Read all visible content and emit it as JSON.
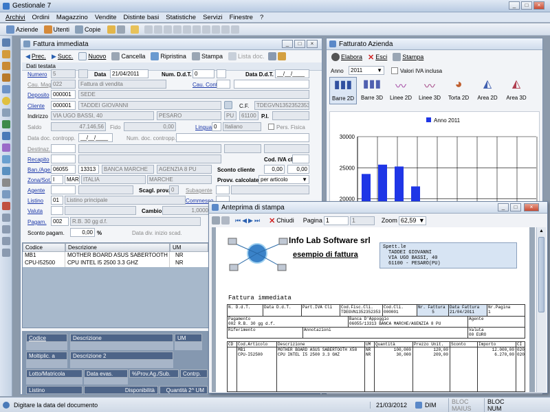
{
  "app": {
    "title": "Gestionale 7"
  },
  "menu": [
    "Archivi",
    "Ordini",
    "Magazzino",
    "Vendite",
    "Distinte basi",
    "Statistiche",
    "Servizi",
    "Finestre",
    "?"
  ],
  "toolbar": {
    "aziende": "Aziende",
    "utenti": "Utenti",
    "copie": "Copie"
  },
  "fattura": {
    "title": "Fattura immediata",
    "toolbar": {
      "prec": "Prec.",
      "succ": "Succ.",
      "nuovo": "Nuovo",
      "cancella": "Cancella",
      "ripristina": "Ripristina",
      "stampa": "Stampa",
      "lista": "Lista doc."
    },
    "section": "Dati testata",
    "numero_label": "Numero",
    "numero": "5",
    "data_label": "Data",
    "data": "21/04/2011",
    "num_ddt_label": "Num. D.d.T.",
    "num_ddt": "0",
    "data_ddt_label": "Data D.d.T.",
    "data_ddt": "__/__/____",
    "cau_mag_label": "Cau. Mag.",
    "cau_mag": "022",
    "cau_mag_desc": "Fattura di vendita",
    "cau_cont_label": "Cau. Cont.",
    "deposito_label": "Deposito",
    "deposito": "000001",
    "deposito_desc": "SEDE",
    "cliente_label": "Cliente",
    "cliente": "000001",
    "cliente_desc": "TADDEI GIOVANNI",
    "cf_label": "C.F.",
    "cf": "TDEGVN1352352353",
    "indirizzo_label": "Indirizzo",
    "indirizzo": "VIA UGO BASSI, 40",
    "citta": "PESARO",
    "prov": "PU",
    "cap": "61100",
    "pi_label": "P.I.",
    "saldo_label": "Saldo",
    "saldo": "47.146,56",
    "fido_label": "Fido",
    "fido": "0,00",
    "lingua_label": "Lingua",
    "lingua": "0",
    "lingua_desc": "Italiano",
    "pers_fisica": "Pers. Fisica",
    "data_doc_label": "Data doc. contropp.",
    "data_doc": "__/__/____",
    "num_doc_label": "Num. doc. contropp.",
    "destinaz_label": "Destinaz.",
    "recapito_label": "Recapito",
    "cod_iva_label": "Cod. IVA cl.",
    "ban_label": "Ban./Age.",
    "abi": "06055",
    "cab": "13313",
    "banca": "BANCA MARCHE",
    "agenzia": "AGENZIA 8 PU",
    "sconto_cliente_label": "Sconto cliente",
    "sconto1": "0,00",
    "sconto2": "0,00",
    "zona_label": "Zona/Sot.",
    "zona": "I",
    "sot": "MAR",
    "zona_desc": "ITALIA",
    "sot_desc": "MARCHE",
    "provv_label": "Provv. calcolate",
    "provv": "per articolo",
    "agente_label": "Agente",
    "scagl_label": "Scagl. prov.",
    "scagl": "0",
    "subagente_label": "Subagente",
    "listino_label": "Listino",
    "listino": "01",
    "listino_desc": "Listino principale",
    "commesso_label": "Commesso",
    "valuta_label": "Valuta",
    "cambio_label": "Cambio",
    "cambio": "1,0000",
    "pagam_label": "Pagam.",
    "pagam": "002",
    "pagam_desc": "R.B. 30 gg d.f.",
    "sconto_pag_label": "Sconto pagam.",
    "sconto_pag": "0,00",
    "perc": "%",
    "data_div_label": "Data div. inizio scad.",
    "grid_headers": [
      "Codice",
      "Descrizione",
      "UM"
    ],
    "rows": [
      {
        "codice": "MB1",
        "descr": "MOTHER BOARD ASUS SABERTOOTH X58",
        "um": "NR"
      },
      {
        "codice": "CPU-I52500",
        "descr": "CPU INTEL I5 2500 3.3 GHZ",
        "um": "NR"
      }
    ],
    "bottom": {
      "codice": "Codice",
      "descrizione": "Descrizione",
      "um": "UM",
      "moltiplic": "Moltiplic. a UM1",
      "descrizione2": "Descrizione 2",
      "lotto": "Lotto/Matricola",
      "data_evas": "Data evas.",
      "prov_ag": "%Prov.Ag./Sub.",
      "controp": "Contrp.",
      "listino": "Listino",
      "disponibilita": "Disponibilità",
      "quantita": "Quantità 2^ UM"
    }
  },
  "fatturato": {
    "title": "Fatturato Azienda",
    "elabora": "Elabora",
    "esci": "Esci",
    "stampa": "Stampa",
    "anno_label": "Anno",
    "anno": "2011",
    "iva_label": "Valori IVA inclusa",
    "types": [
      "Barre 2D",
      "Barre 3D",
      "Linee 2D",
      "Linee 3D",
      "Torta 2D",
      "Area 2D",
      "Area 3D"
    ]
  },
  "chart_data": {
    "type": "bar",
    "series": [
      {
        "name": "Anno 2011",
        "values": [
          24000,
          25500,
          25200,
          22000
        ]
      }
    ],
    "categories": [
      "1",
      "2",
      "3",
      "4"
    ],
    "yticks": [
      30000,
      25000,
      20000,
      15000
    ],
    "ylim": [
      13000,
      30000
    ]
  },
  "anteprima": {
    "title": "Anteprima di stampa",
    "chiudi": "Chiudi",
    "pagina_label": "Pagina",
    "pagina": "1",
    "pagina_tot": "1",
    "zoom_label": "Zoom",
    "zoom": "62,59",
    "company": "Info Lab Software srl",
    "subtitle": "esempio di fattura",
    "spett": "Spett.le",
    "dest1": "TADDEI GIOVANNI",
    "dest2": "VIA UGO BASSI, 40",
    "dest3": "61100 - PESARO(PU)",
    "doc_title": "Fattura immediata",
    "h1": [
      "N. D.d.T.",
      "Data D.d.T.",
      "Part.IVA Cli",
      "Cod.Fisc.Cli.",
      "Cod.Cli.",
      "Nr. Fattura",
      "Data Fattura",
      "Nr.Pagina"
    ],
    "v1": [
      "",
      "",
      "",
      "TDEGVN1352352353",
      "000001",
      "5",
      "21/04/2011",
      "1"
    ],
    "pag_label": "Pagamento",
    "pag": "002 R.B. 30 gg d.f.",
    "banca_label": "Banca D'Appoggio",
    "banca": "06055/13313 BANCA MARCHE/AGENZIA 8 PU",
    "agente_label": "Agente",
    "rif_label": "Riferimento",
    "annot_label": "Annotazioni",
    "valuta_label": "Valuta",
    "valuta": "00 EURO",
    "th": [
      "CD",
      "Cod.Articolo",
      "Descrizione",
      "UM",
      "Quantità",
      "Prezzo Unit.",
      "Sconto",
      "Importo",
      "CI"
    ],
    "tr": [
      {
        "cod": "MB1",
        "descr": "MOTHER BOARD ASUS SABERTOOTH X58",
        "um": "NR",
        "qta": "100,000",
        "prezzo": "120,00",
        "importo": "12.000,00",
        "ci": "020"
      },
      {
        "cod": "CPU-I52500",
        "descr": "CPU INTEL I5 2500 3.3 GHZ",
        "um": "NR",
        "qta": "30,000",
        "prezzo": "209,00",
        "importo": "6.270,00",
        "ci": "020"
      }
    ]
  },
  "status": {
    "msg": "Digitare la data del documento",
    "date": "21/03/2012",
    "dim": "DIM",
    "maius": "BLOC MAIUS",
    "num": "BLOC NUM"
  }
}
